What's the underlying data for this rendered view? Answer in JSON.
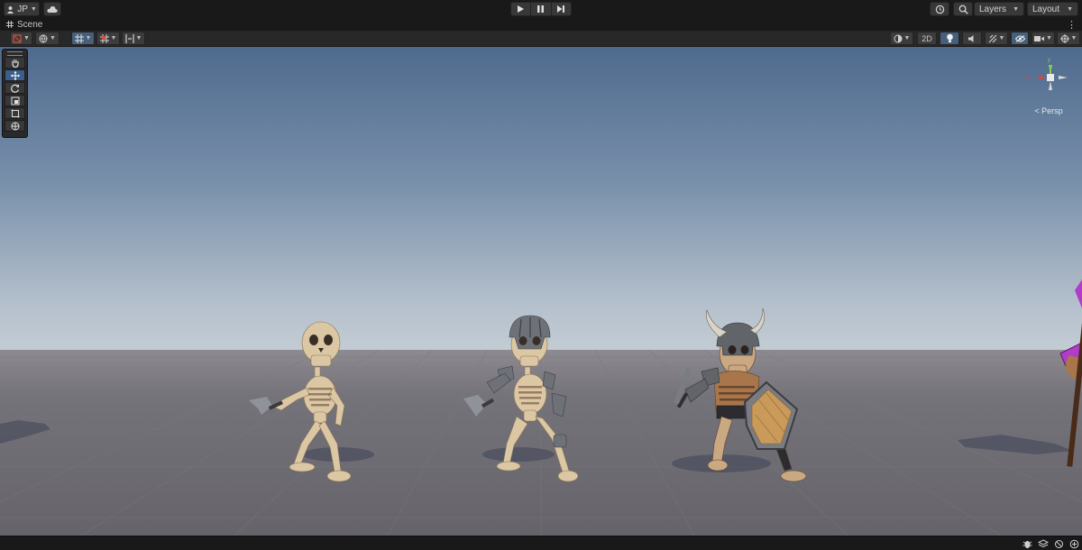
{
  "toolbar": {
    "account_label": "JP",
    "cloud_icon": "cloud-icon",
    "play_icons": [
      "play-icon",
      "pause-icon",
      "step-icon"
    ],
    "layers_label": "Layers",
    "layout_label": "Layout"
  },
  "tab": {
    "scene_label": "Scene",
    "menu_icon": "⋮"
  },
  "scene_toolbar": {
    "mode_2d_label": "2D",
    "right_icons": [
      "shading-mode-icon",
      "2d-toggle",
      "lighting-icon",
      "audio-icon",
      "effects-icon",
      "visibility-icon",
      "camera-icon",
      "gizmos-icon"
    ]
  },
  "tools": [
    "hand-tool",
    "move-tool",
    "rotate-tool",
    "scale-tool",
    "rect-tool",
    "transform-tool"
  ],
  "gizmo": {
    "projection_label": "Persp",
    "axis_x": "x",
    "axis_y": "y"
  },
  "colors": {
    "sky_top": "#4e6a8d",
    "sky_horizon": "#c3ccd4",
    "ground": "#6c6a70",
    "bone": "#dcc7a4",
    "metal": "#6e7178",
    "wood": "#c99a5a",
    "accent_active": "#46607c"
  },
  "scene_objects": [
    "skeleton-plain",
    "skeleton-helmet",
    "skeleton-viking-shield",
    "offscreen-mage"
  ]
}
